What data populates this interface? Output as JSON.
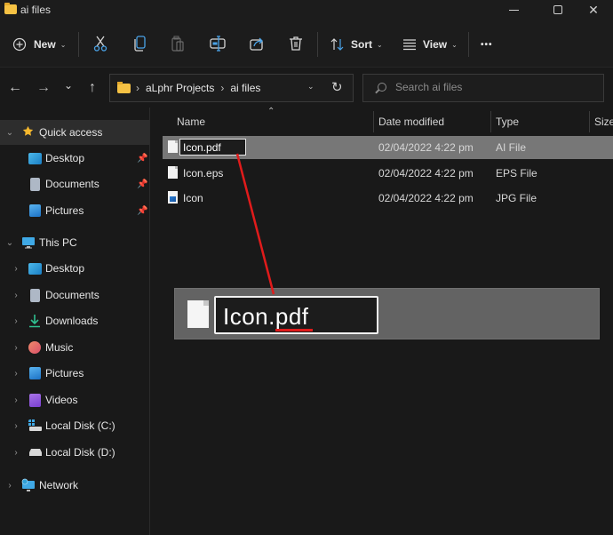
{
  "window": {
    "title": "ai files",
    "controls": {
      "minimize": "minimize",
      "maximize": "maximize",
      "close": "✕"
    }
  },
  "toolbar": {
    "new_label": "New",
    "sort_label": "Sort",
    "view_label": "View",
    "more_label": "•••",
    "icons": [
      "cut-icon",
      "copy-icon",
      "paste-icon",
      "rename-icon",
      "share-icon",
      "delete-icon"
    ]
  },
  "navigation": {
    "back": "←",
    "forward": "→",
    "recent": "⌄",
    "up": "↑",
    "breadcrumbs": [
      "aLphr Projects",
      "ai files"
    ],
    "crumb_sep": "›",
    "refresh": "↻",
    "search_placeholder": "Search ai files"
  },
  "sidebar": {
    "quick_access": {
      "label": "Quick access",
      "items": [
        {
          "label": "Desktop",
          "pinned": true
        },
        {
          "label": "Documents",
          "pinned": true
        },
        {
          "label": "Pictures",
          "pinned": true
        }
      ]
    },
    "this_pc": {
      "label": "This PC",
      "items": [
        {
          "label": "Desktop"
        },
        {
          "label": "Documents"
        },
        {
          "label": "Downloads"
        },
        {
          "label": "Music"
        },
        {
          "label": "Pictures"
        },
        {
          "label": "Videos"
        },
        {
          "label": "Local Disk (C:)"
        },
        {
          "label": "Local Disk (D:)"
        }
      ]
    },
    "network": {
      "label": "Network"
    }
  },
  "columns": {
    "name": "Name",
    "date": "Date modified",
    "type": "Type",
    "size": "Size"
  },
  "files": [
    {
      "name": "Icon.pdf",
      "date": "02/04/2022 4:22 pm",
      "type": "AI File",
      "selected": true,
      "renaming": true
    },
    {
      "name": "Icon.eps",
      "date": "02/04/2022 4:22 pm",
      "type": "EPS File"
    },
    {
      "name": "Icon",
      "date": "02/04/2022 4:22 pm",
      "type": "JPG File"
    }
  ],
  "callout": {
    "text": "Icon.pdf",
    "highlight": ".pdf"
  },
  "colors": {
    "annotation_red": "#e01b1b",
    "selection": "#777777",
    "folder": "#f6c244"
  }
}
